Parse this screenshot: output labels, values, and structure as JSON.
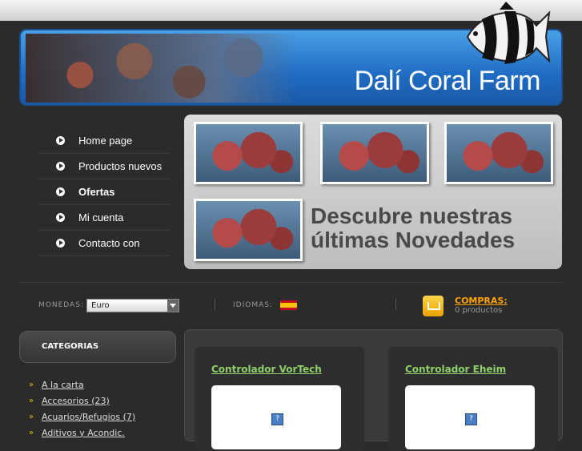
{
  "header": {
    "brand": "Dalí Coral Farm"
  },
  "menu": [
    {
      "label": "Home page",
      "bold": false
    },
    {
      "label": "Productos nuevos",
      "bold": false
    },
    {
      "label": "Ofertas",
      "bold": true
    },
    {
      "label": "Mi cuenta",
      "bold": false
    },
    {
      "label": "Contacto con",
      "bold": false
    }
  ],
  "promo": {
    "line1": "Descubre nuestras",
    "line2": "últimas Novedades"
  },
  "toolbar": {
    "currency_label": "MONEDAS:",
    "currency_value": "Euro",
    "language_label": "IDIOMAS:",
    "cart_title": "COMPRAS:",
    "cart_count": "0 productos"
  },
  "categories": {
    "title": "CATEGORIAS",
    "items": [
      "A la carta",
      "Accesorios (23)",
      "Acuarios/Refugios (7)",
      "Aditivos y Acondic."
    ]
  },
  "products": [
    {
      "title": "Controlador VorTech",
      "image_icon": "?"
    },
    {
      "title": "Controlador Eheim",
      "image_icon": "?"
    }
  ]
}
